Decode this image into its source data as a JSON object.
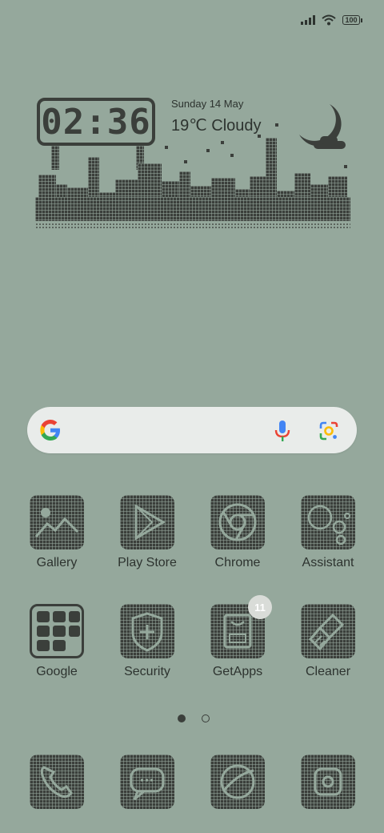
{
  "status_bar": {
    "battery": "100",
    "icons": [
      "signal-icon",
      "wifi-icon",
      "battery-icon"
    ]
  },
  "widget": {
    "time": "02:36",
    "date": "Sunday 14 May",
    "weather": "19℃  Cloudy"
  },
  "search": {
    "icons": [
      "google-logo",
      "mic-icon",
      "lens-icon"
    ]
  },
  "apps": [
    {
      "label": "Gallery",
      "icon": "gallery-icon"
    },
    {
      "label": "Play Store",
      "icon": "play-store-icon"
    },
    {
      "label": "Chrome",
      "icon": "chrome-icon"
    },
    {
      "label": "Assistant",
      "icon": "assistant-icon"
    },
    {
      "label": "Google",
      "icon": "google-folder-icon"
    },
    {
      "label": "Security",
      "icon": "security-icon"
    },
    {
      "label": "GetApps",
      "icon": "getapps-icon",
      "badge": "11"
    },
    {
      "label": "Cleaner",
      "icon": "cleaner-icon"
    }
  ],
  "pager": {
    "pages": 2,
    "active": 1
  },
  "dock": [
    "phone-icon",
    "messages-icon",
    "browser-icon",
    "camera-icon"
  ],
  "colors": {
    "background": "#95a89c",
    "pixel_dark": "#3b3f3b",
    "search_bg": "#e9ecea",
    "badge_bg": "#d9dcd8"
  }
}
